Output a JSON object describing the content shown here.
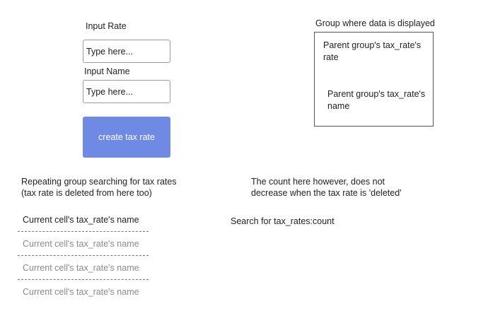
{
  "form": {
    "rate_label": "Input Rate",
    "rate_placeholder": "Type here...",
    "name_label": "Input Name",
    "name_placeholder": "Type here...",
    "create_button_label": "create tax rate"
  },
  "display_group": {
    "caption": "Group where data is displayed",
    "rate_text": "Parent group's tax_rate's rate",
    "name_text": "Parent group's tax_rate's name"
  },
  "repeating_group": {
    "caption_line1": "Repeating group searching for tax rates",
    "caption_line2": "(tax rate is deleted from here too)",
    "rows": [
      "Current cell's tax_rate's name",
      "Current cell's tax_rate's name",
      "Current cell's tax_rate's name",
      "Current cell's tax_rate's name"
    ]
  },
  "count_note": {
    "line1": "The count here however, does not",
    "line2": "decrease when the tax rate is 'deleted'",
    "count_text": "Search for tax_rates:count"
  },
  "colors": {
    "button_bg": "#6f8ae5",
    "muted_text": "#8a8a8a"
  }
}
